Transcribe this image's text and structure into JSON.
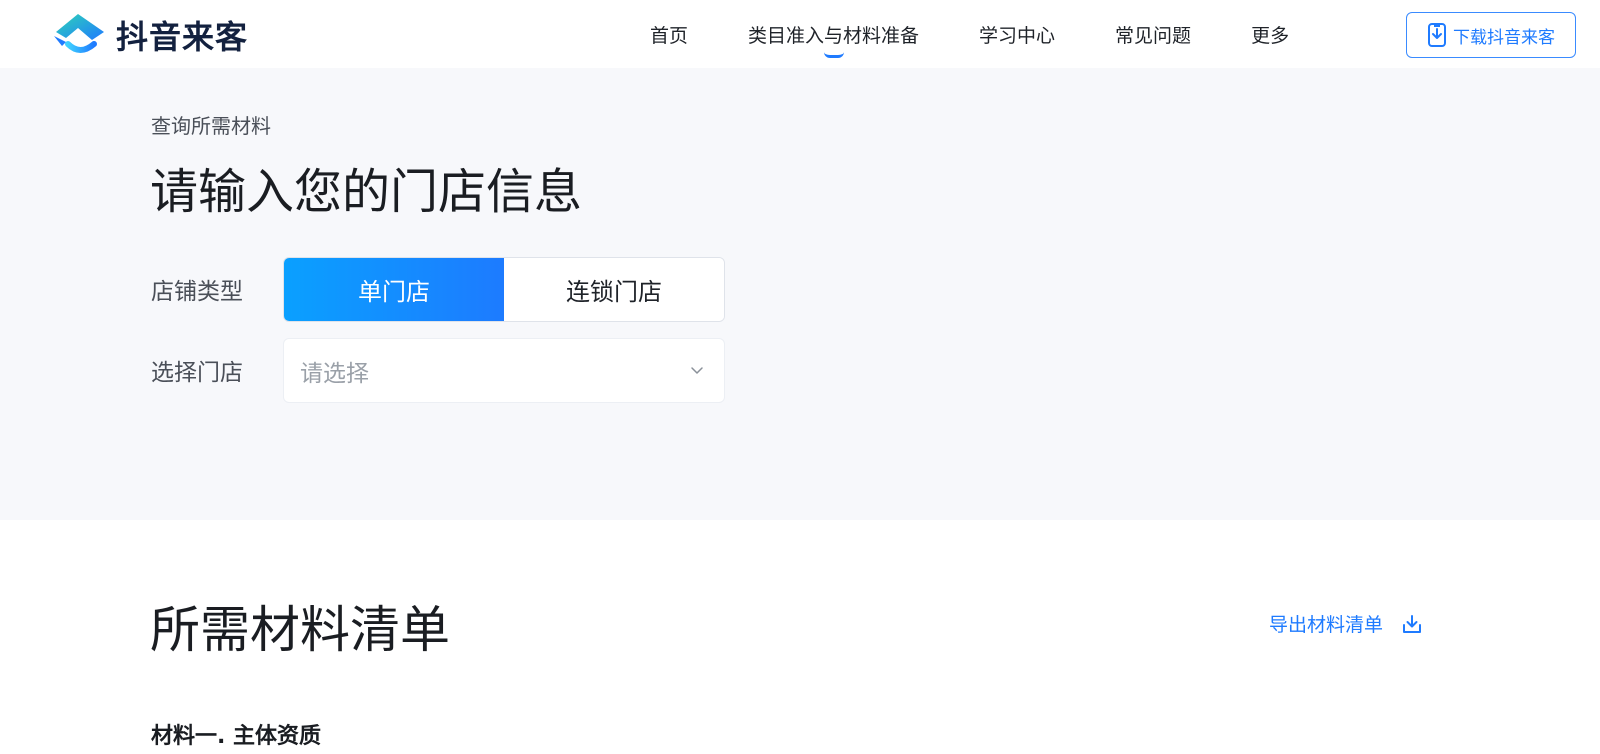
{
  "app": {
    "brand_name": "抖音来客"
  },
  "nav": {
    "items": [
      {
        "label": "首页"
      },
      {
        "label": "类目准入与材料准备",
        "active": true
      },
      {
        "label": "学习中心"
      },
      {
        "label": "常见问题"
      },
      {
        "label": "更多"
      }
    ],
    "download_label": "下载抖音来客"
  },
  "store_form": {
    "eyebrow": "查询所需材料",
    "title": "请输入您的门店信息",
    "type_label": "店铺类型",
    "type_options": [
      "单门店",
      "连锁门店"
    ],
    "type_selected": "单门店",
    "select_label": "选择门店",
    "select_placeholder": "请选择"
  },
  "materials": {
    "title": "所需材料清单",
    "export_label": "导出材料清单",
    "first_heading": "材料一. 主体资质"
  },
  "colors": {
    "accent": "#1f7bff",
    "accent_gradient_start": "#0aa0ff",
    "brand_text": "#13213f",
    "section_bg": "#f7f8fb"
  },
  "icons": {
    "logo": "douyin-laike-logo",
    "download": "download-phone-icon",
    "select_arrow": "chevron-down-icon",
    "export": "download-tray-icon"
  }
}
